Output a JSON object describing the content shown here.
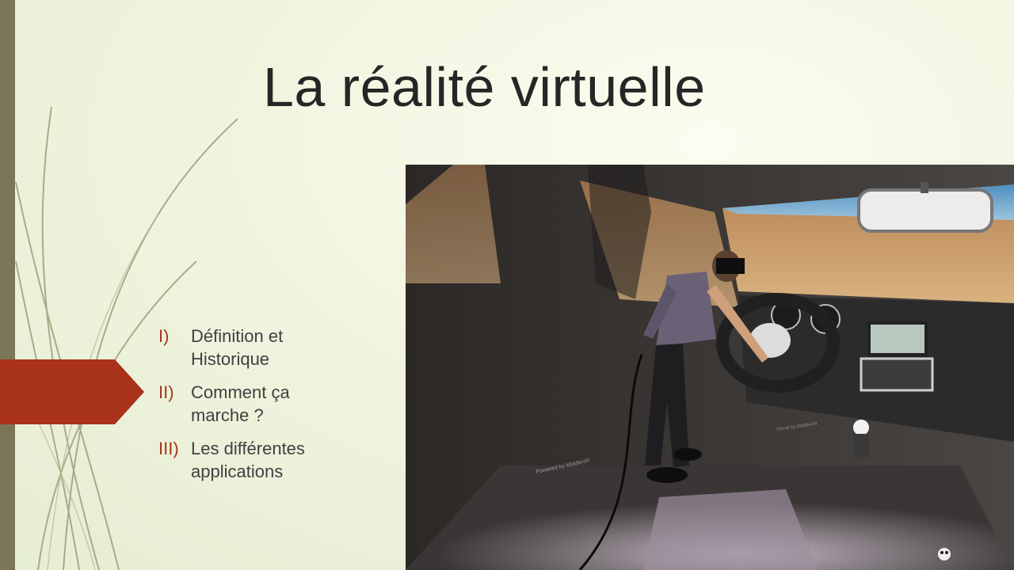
{
  "slide": {
    "title": "La réalité virtuelle",
    "agenda": [
      {
        "num": "I)",
        "text": "Définition et Historique"
      },
      {
        "num": "II)",
        "text": "Comment ça marche ?"
      },
      {
        "num": "III)",
        "text": "Les différentes applications"
      }
    ],
    "photo": {
      "watermark_left": "Powered by MiddleVR",
      "watermark_right": "Virtual by MiddleVR"
    }
  },
  "colors": {
    "accent": "#A5361A",
    "arrow": "#A8321A",
    "side_bar": "#7B7658",
    "background": "#F1F5E0"
  }
}
